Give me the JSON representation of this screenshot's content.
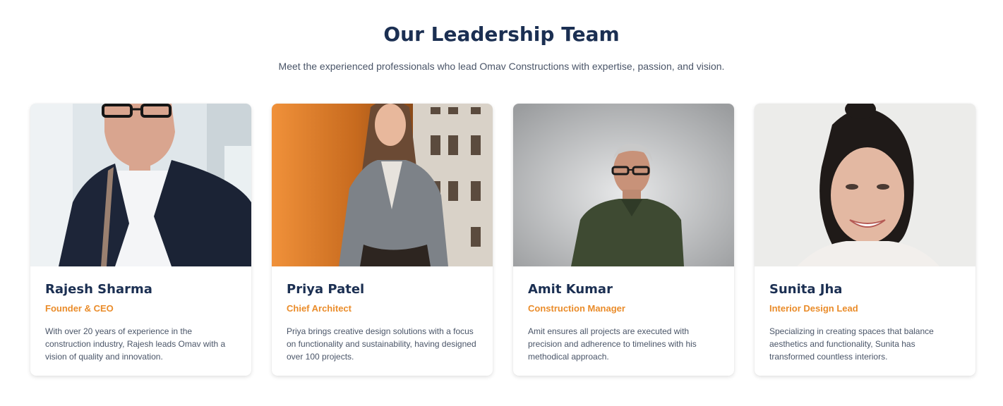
{
  "section": {
    "title": "Our Leadership Team",
    "subtitle": "Meet the experienced professionals who lead Omav Constructions with expertise, passion, and vision."
  },
  "colors": {
    "heading": "#1b2f52",
    "accent": "#ea8c2a",
    "text": "#4a5568"
  },
  "members": [
    {
      "name": "Rajesh Sharma",
      "role": "Founder & CEO",
      "description": "With over 20 years of experience in the construction industry, Rajesh leads Omav with a vision of quality and innovation.",
      "photo": "man-in-dark-blazer-with-glasses-photo"
    },
    {
      "name": "Priya Patel",
      "role": "Chief Architect",
      "description": "Priya brings creative design solutions with a focus on functionality and sustainability, having designed over 100 projects.",
      "photo": "woman-in-grey-blazer-photo"
    },
    {
      "name": "Amit Kumar",
      "role": "Construction Manager",
      "description": "Amit ensures all projects are executed with precision and adherence to timelines with his methodical approach.",
      "photo": "man-in-green-polo-photo"
    },
    {
      "name": "Sunita Jha",
      "role": "Interior Design Lead",
      "description": "Specializing in creating spaces that balance aesthetics and functionality, Sunita has transformed countless interiors.",
      "photo": "smiling-woman-portrait-photo"
    }
  ]
}
